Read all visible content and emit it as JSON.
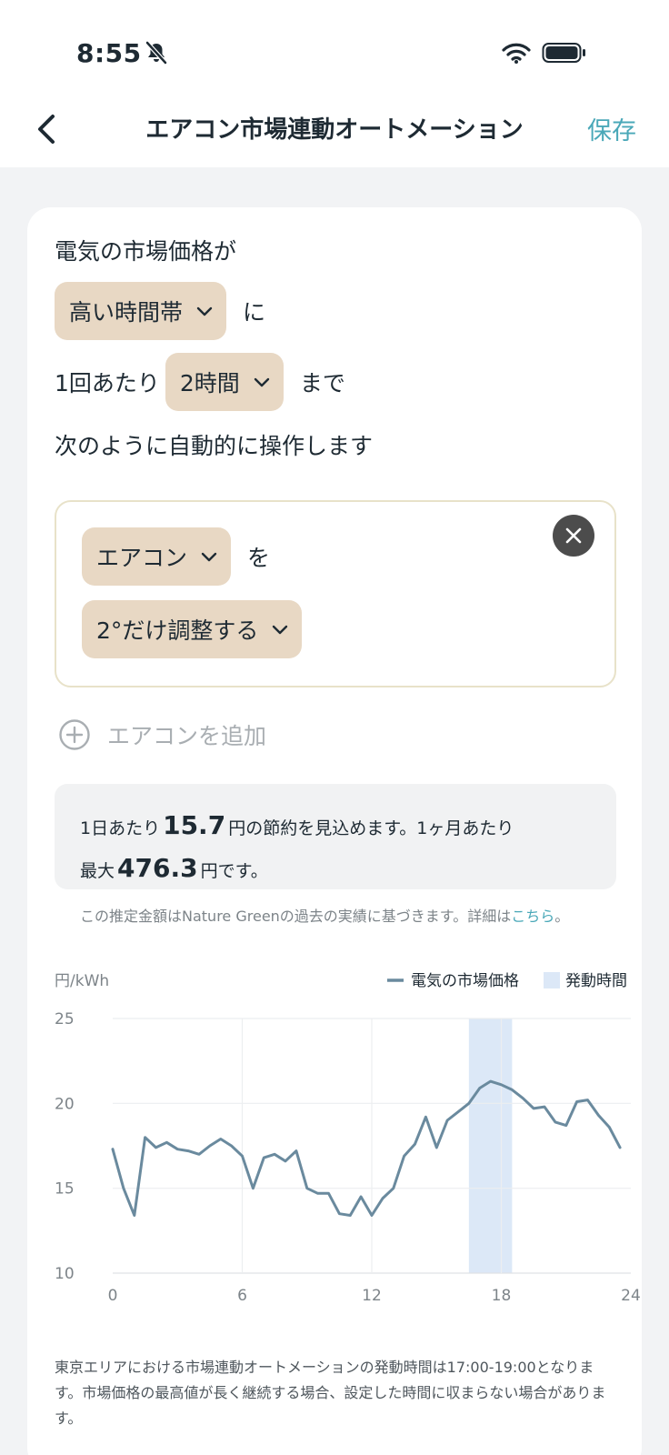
{
  "status_bar": {
    "time": "8:55"
  },
  "nav": {
    "title": "エアコン市場連動オートメーション",
    "save_label": "保存"
  },
  "condition": {
    "intro": "電気の市場価格が",
    "timeband": "高い時間帯",
    "suffix_1": "に",
    "prefix_2": "1回あたり",
    "duration": "2時間",
    "suffix_2": "まで",
    "line_3": "次のように自動的に操作します"
  },
  "action": {
    "device": "エアコン",
    "particle": "を",
    "operation": "2°だけ調整する"
  },
  "add_label": "エアコンを追加",
  "savings": {
    "part1": "1日あたり",
    "daily": "15.7",
    "part2": "円の節約を見込めます。1ヶ月あたり",
    "part3": "最大",
    "monthly": "476.3",
    "part4": "円です。"
  },
  "disclaimer": {
    "text": "この推定金額はNature Greenの過去の実績に基づきます。詳細は",
    "link": "こちら",
    "end": "。"
  },
  "chart_data": {
    "type": "line",
    "ylabel": "円/kWh",
    "legend": [
      {
        "label": "電気の市場価格",
        "color": "#6a8a9e"
      },
      {
        "label": "発動時間",
        "color": "#dce8f7"
      }
    ],
    "yticks": [
      25,
      20,
      15,
      10
    ],
    "xticks": [
      0,
      6,
      12,
      18,
      24
    ],
    "ylim": [
      10,
      25
    ],
    "xlim": [
      0,
      24
    ],
    "active_period": [
      16.5,
      18.5
    ],
    "series": [
      {
        "color": "#6a8a9e",
        "x": [
          0,
          0.5,
          1,
          1.5,
          2,
          2.5,
          3,
          3.5,
          4,
          4.5,
          5,
          5.5,
          6,
          6.5,
          7,
          7.5,
          8,
          8.5,
          9,
          9.5,
          10,
          10.5,
          11,
          11.5,
          12,
          12.5,
          13,
          13.5,
          14,
          14.5,
          15,
          15.5,
          16,
          16.5,
          17,
          17.5,
          18,
          18.5,
          19,
          19.5,
          20,
          20.5,
          21,
          21.5,
          22,
          22.5,
          23,
          23.5
        ],
        "values": [
          17.3,
          15.0,
          13.4,
          18.0,
          17.4,
          17.7,
          17.3,
          17.2,
          17.0,
          17.5,
          17.9,
          17.5,
          16.9,
          15.0,
          16.8,
          17.0,
          16.6,
          17.2,
          15.0,
          14.7,
          14.7,
          13.5,
          13.4,
          14.5,
          13.4,
          14.4,
          15.0,
          16.9,
          17.6,
          19.2,
          17.4,
          19.0,
          19.5,
          20.0,
          20.9,
          21.3,
          21.1,
          20.8,
          20.3,
          19.7,
          19.8,
          18.9,
          18.7,
          20.1,
          20.2,
          19.3,
          18.6,
          17.4
        ]
      }
    ]
  },
  "footer": "東京エリアにおける市場連動オートメーションの発動時間は17:00-19:00となります。市場価格の最高値が長く継続する場合、設定した時間に収まらない場合があります。"
}
